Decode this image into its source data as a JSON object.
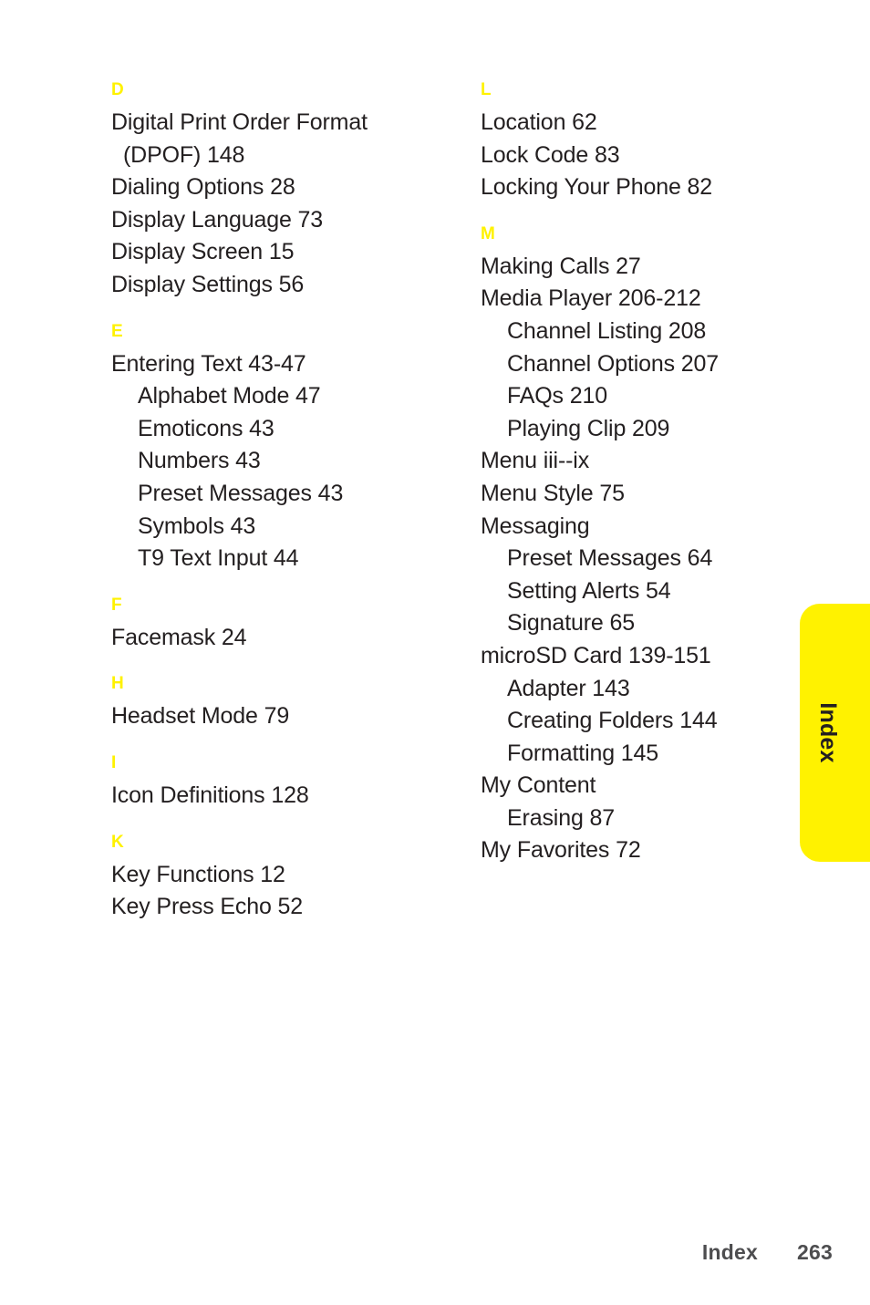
{
  "page": {
    "background_color": "#ffffff",
    "text_color": "#231f20",
    "accent_color": "#fff200"
  },
  "side_tab": {
    "label": "Index",
    "color": "#fff200"
  },
  "footer": {
    "label": "Index",
    "page_number": "263"
  },
  "columns": [
    {
      "id": "left",
      "sections": [
        {
          "letter": "D",
          "entries": [
            {
              "text": "Digital Print Order Format",
              "level": 0,
              "wrap": false
            },
            {
              "text": "(DPOF) 148",
              "level": 0,
              "wrap": true
            },
            {
              "text": "Dialing Options 28",
              "level": 0,
              "wrap": false
            },
            {
              "text": "Display Language 73",
              "level": 0,
              "wrap": false
            },
            {
              "text": "Display Screen 15",
              "level": 0,
              "wrap": false
            },
            {
              "text": "Display Settings 56",
              "level": 0,
              "wrap": false
            }
          ]
        },
        {
          "letter": "E",
          "entries": [
            {
              "text": "Entering Text 43-47",
              "level": 0,
              "wrap": false
            },
            {
              "text": "Alphabet Mode 47",
              "level": 1,
              "wrap": false
            },
            {
              "text": "Emoticons 43",
              "level": 1,
              "wrap": false
            },
            {
              "text": "Numbers 43",
              "level": 1,
              "wrap": false
            },
            {
              "text": "Preset Messages 43",
              "level": 1,
              "wrap": false
            },
            {
              "text": "Symbols 43",
              "level": 1,
              "wrap": false
            },
            {
              "text": "T9 Text Input 44",
              "level": 1,
              "wrap": false
            }
          ]
        },
        {
          "letter": "F",
          "entries": [
            {
              "text": "Facemask 24",
              "level": 0,
              "wrap": false
            }
          ]
        },
        {
          "letter": "H",
          "entries": [
            {
              "text": "Headset Mode 79",
              "level": 0,
              "wrap": false
            }
          ]
        },
        {
          "letter": "I",
          "entries": [
            {
              "text": "Icon Definitions 128",
              "level": 0,
              "wrap": false
            }
          ]
        },
        {
          "letter": "K",
          "entries": [
            {
              "text": "Key Functions 12",
              "level": 0,
              "wrap": false
            },
            {
              "text": "Key Press Echo 52",
              "level": 0,
              "wrap": false
            }
          ]
        }
      ]
    },
    {
      "id": "right",
      "sections": [
        {
          "letter": "L",
          "entries": [
            {
              "text": "Location 62",
              "level": 0,
              "wrap": false
            },
            {
              "text": "Lock Code 83",
              "level": 0,
              "wrap": false
            },
            {
              "text": "Locking Your Phone 82",
              "level": 0,
              "wrap": false
            }
          ]
        },
        {
          "letter": "M",
          "entries": [
            {
              "text": "Making Calls 27",
              "level": 0,
              "wrap": false
            },
            {
              "text": "Media Player 206-212",
              "level": 0,
              "wrap": false
            },
            {
              "text": "Channel Listing 208",
              "level": 1,
              "wrap": false
            },
            {
              "text": "Channel Options 207",
              "level": 1,
              "wrap": false
            },
            {
              "text": "FAQs 210",
              "level": 1,
              "wrap": false
            },
            {
              "text": "Playing Clip 209",
              "level": 1,
              "wrap": false
            },
            {
              "text": "Menu iii--ix",
              "level": 0,
              "wrap": false
            },
            {
              "text": "Menu Style 75",
              "level": 0,
              "wrap": false
            },
            {
              "text": "Messaging",
              "level": 0,
              "wrap": false
            },
            {
              "text": "Preset Messages 64",
              "level": 1,
              "wrap": false
            },
            {
              "text": "Setting Alerts 54",
              "level": 1,
              "wrap": false
            },
            {
              "text": "Signature 65",
              "level": 1,
              "wrap": false
            },
            {
              "text": "microSD Card 139-151",
              "level": 0,
              "wrap": false
            },
            {
              "text": "Adapter 143",
              "level": 1,
              "wrap": false
            },
            {
              "text": "Creating Folders 144",
              "level": 1,
              "wrap": false
            },
            {
              "text": "Formatting 145",
              "level": 1,
              "wrap": false
            },
            {
              "text": "My Content",
              "level": 0,
              "wrap": false
            },
            {
              "text": "Erasing 87",
              "level": 1,
              "wrap": false
            },
            {
              "text": "My Favorites 72",
              "level": 0,
              "wrap": false
            }
          ]
        }
      ]
    }
  ]
}
